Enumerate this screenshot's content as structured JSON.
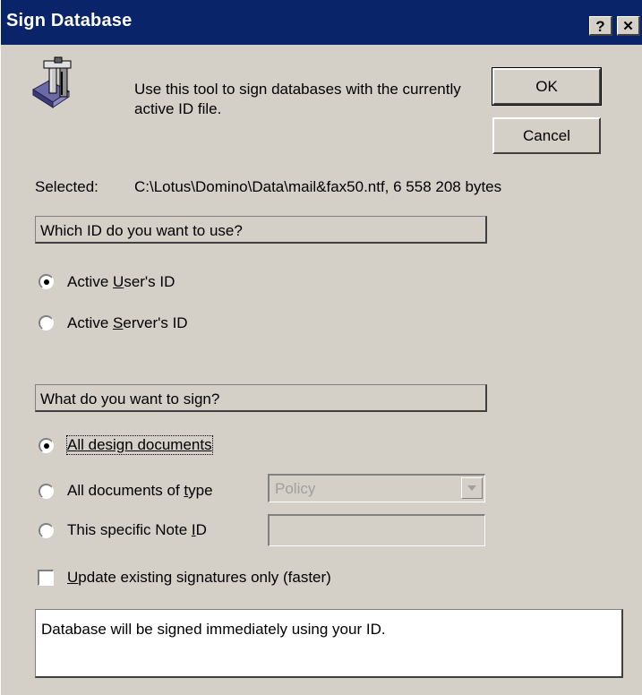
{
  "window": {
    "title": "Sign Database",
    "help_label": "?",
    "close_label": "✕"
  },
  "intro_text": "Use this tool to sign databases with the currently active ID file.",
  "buttons": {
    "ok": "OK",
    "cancel": "Cancel"
  },
  "selected": {
    "label": "Selected:",
    "value": "C:\\Lotus\\Domino\\Data\\mail&fax50.ntf, 6 558 208 bytes"
  },
  "id_section": {
    "title": "Which ID do you want to use?",
    "options": [
      {
        "pre": "Active ",
        "key": "U",
        "post": "ser's ID",
        "selected": true
      },
      {
        "pre": "Active ",
        "key": "S",
        "post": "erver's ID",
        "selected": false
      }
    ]
  },
  "sign_section": {
    "title": "What do you want to sign?",
    "options": [
      {
        "pre": "",
        "key": "A",
        "post": "ll design documents",
        "selected": true
      },
      {
        "pre": "All documents of ",
        "key": "t",
        "post": "ype",
        "selected": false
      },
      {
        "pre": "This specific Note ",
        "key": "I",
        "post": "D",
        "selected": false
      }
    ],
    "type_dropdown_value": "Policy",
    "note_id_value": ""
  },
  "update_checkbox": {
    "key": "U",
    "post": "pdate existing signatures only (faster)",
    "checked": false
  },
  "message": "Database will be signed immediately using your ID.",
  "colors": {
    "face": "#d4d0c8",
    "title_bar": "#0a246a",
    "disabled_text": "#a0a0a0"
  },
  "icon": "signing-tool-icon"
}
